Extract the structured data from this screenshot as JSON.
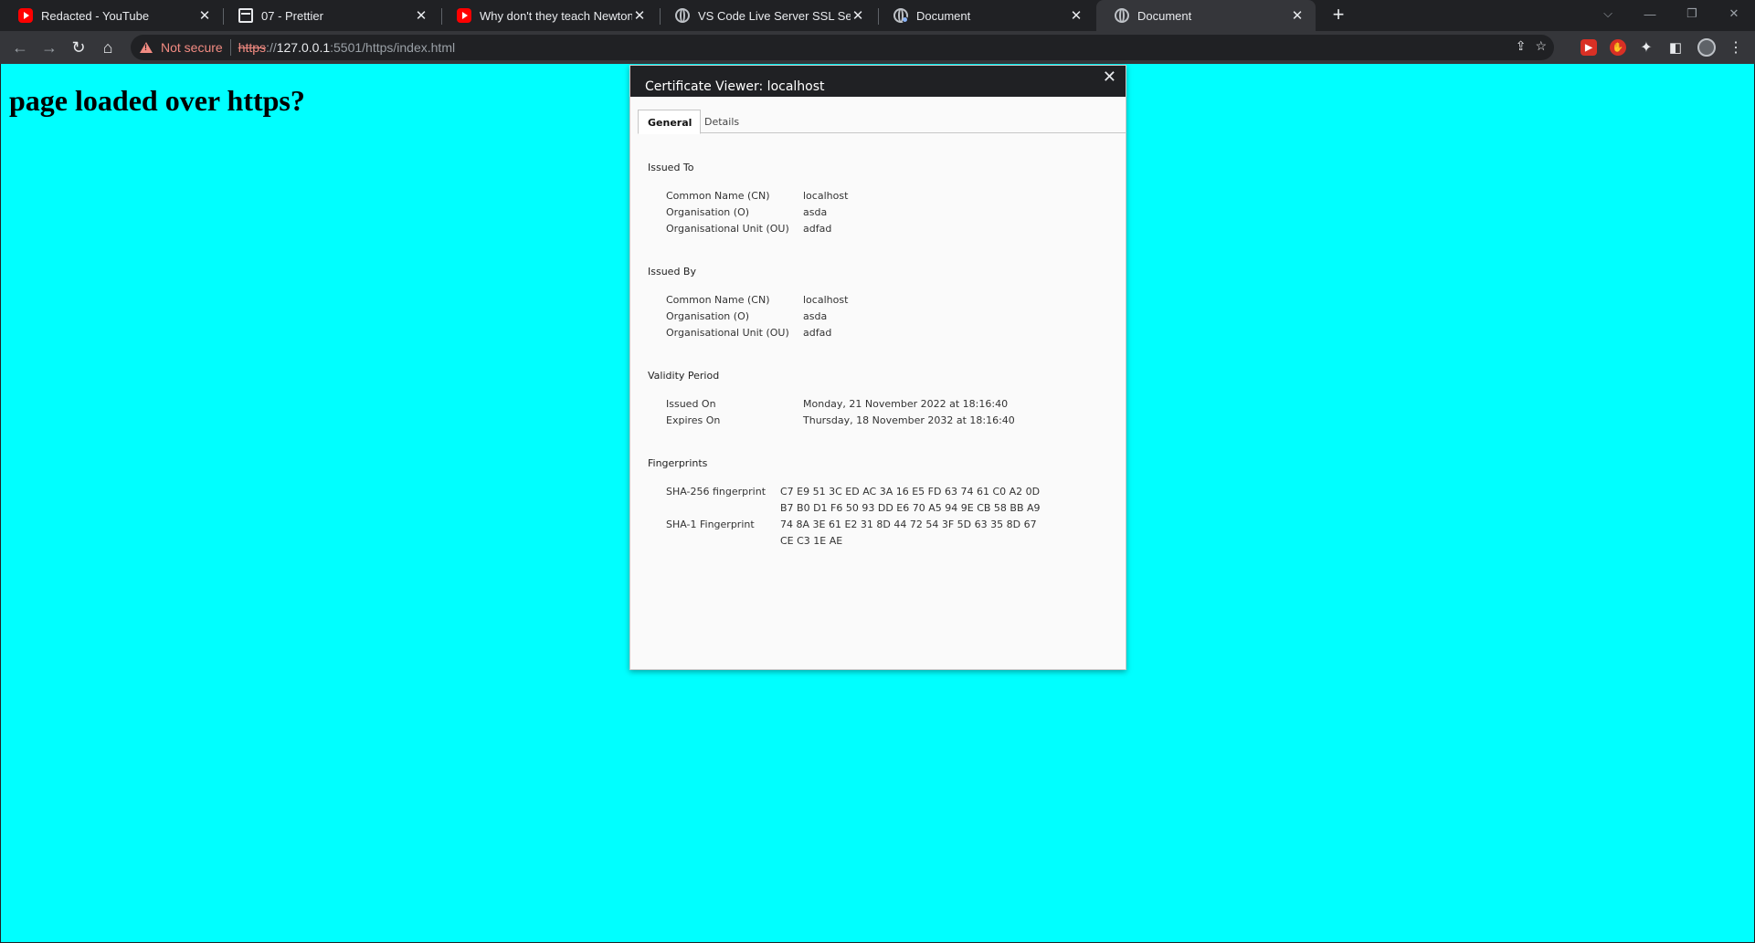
{
  "browser": {
    "tabs": [
      {
        "title": "Redacted - YouTube",
        "icon": "youtube-icon"
      },
      {
        "title": "07 - Prettier",
        "icon": "document-icon"
      },
      {
        "title": "Why don't they teach Newton's c",
        "icon": "youtube-icon"
      },
      {
        "title": "VS Code Live Server SSL Settings",
        "icon": "globe-icon"
      },
      {
        "title": "Document",
        "icon": "globe-icon"
      },
      {
        "title": "Document",
        "icon": "globe-icon",
        "active": true
      }
    ],
    "address": {
      "warning": "Not secure",
      "scheme": "https",
      "scheme_sep": "://",
      "host": "127.0.0.1",
      "path": ":5501/https/index.html"
    },
    "accent": "#00ffff"
  },
  "page": {
    "heading": "page loaded over https?"
  },
  "dialog": {
    "title": "Certificate Viewer: localhost",
    "tabs": [
      "General",
      "Details"
    ],
    "issued_to": {
      "heading": "Issued To",
      "rows": [
        {
          "label": "Common Name (CN)",
          "value": "localhost"
        },
        {
          "label": "Organisation (O)",
          "value": "asda"
        },
        {
          "label": "Organisational Unit (OU)",
          "value": "adfad"
        }
      ]
    },
    "issued_by": {
      "heading": "Issued By",
      "rows": [
        {
          "label": "Common Name (CN)",
          "value": "localhost"
        },
        {
          "label": "Organisation (O)",
          "value": "asda"
        },
        {
          "label": "Organisational Unit (OU)",
          "value": "adfad"
        }
      ]
    },
    "validity": {
      "heading": "Validity Period",
      "rows": [
        {
          "label": "Issued On",
          "value": "Monday, 21 November 2022 at 18:16:40"
        },
        {
          "label": "Expires On",
          "value": "Thursday, 18 November 2032 at 18:16:40"
        }
      ]
    },
    "fingerprints": {
      "heading": "Fingerprints",
      "sha256_label": "SHA-256 fingerprint",
      "sha256_line1": "C7 E9 51 3C ED AC 3A 16 E5 FD 63 74 61 C0 A2 0D",
      "sha256_line2": "B7 B0 D1 F6 50 93 DD E6 70 A5 94 9E CB 58 BB A9",
      "sha1_label": "SHA-1 Fingerprint",
      "sha1_line1": "74 8A 3E 61 E2 31 8D 44 72 54 3F 5D 63 35 8D 67",
      "sha1_line2": "CE C3 1E AE"
    }
  }
}
